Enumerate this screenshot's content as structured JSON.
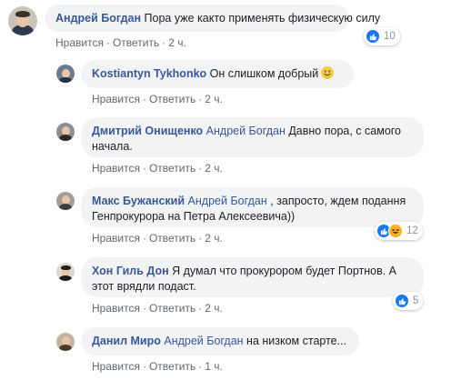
{
  "actions": {
    "like": "Нравится",
    "reply": "Ответить",
    "separator": "·"
  },
  "comments": [
    {
      "author": "Андрей Богдан",
      "mention": "",
      "text": "Пора уже както применять физическую силу",
      "time": "2 ч.",
      "reactions": {
        "icons": [
          "like-icon"
        ],
        "count": "10"
      }
    },
    {
      "author": "Kostiantyn Tykhonko",
      "mention": "",
      "text": "Он слишком добрый",
      "emoji": "smile-emoji-icon",
      "time": "2 ч."
    },
    {
      "author": "Дмитрий Онищенко",
      "mention": "Андрей Богдан",
      "text": "Давно пора, с самого начала.",
      "time": "2 ч."
    },
    {
      "author": "Макс Бужанский",
      "mention": "Андрей Богдан",
      "text": ", запросто, ждем подання Генпрокурора на Петра Алексеевича))",
      "time": "2 ч.",
      "reactions": {
        "icons": [
          "like-icon",
          "haha-icon"
        ],
        "count": "12"
      }
    },
    {
      "author": "Хон Гиль Дон",
      "mention": "",
      "text": "Я думал что прокурором будет Портнов. А этот врядли подаст.",
      "time": "2 ч.",
      "reactions": {
        "icons": [
          "like-icon"
        ],
        "count": "5"
      }
    },
    {
      "author": "Данил Миро",
      "mention": "Андрей Богдан",
      "text": "на низком старте...",
      "time": "1 ч."
    }
  ],
  "colors": {
    "link": "#385898",
    "bubble": "#f2f3f5",
    "meta": "#606770",
    "like": "#1877f2",
    "haha": "#f7b125"
  }
}
